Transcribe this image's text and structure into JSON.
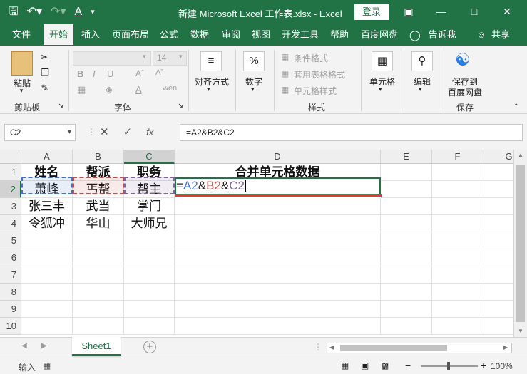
{
  "titlebar": {
    "title": "新建 Microsoft Excel 工作表.xlsx  -  Excel",
    "login": "登录",
    "icons": [
      "save-icon",
      "undo-icon",
      "redo-icon",
      "font-color-icon",
      "customize-icon"
    ]
  },
  "tabs": [
    "文件",
    "开始",
    "插入",
    "页面布局",
    "公式",
    "数据",
    "审阅",
    "视图",
    "开发工具",
    "帮助",
    "百度网盘",
    "告诉我",
    "共享"
  ],
  "ribbon": {
    "paste": "粘贴",
    "clipboard": "剪贴板",
    "font_size": "14",
    "font_group": "字体",
    "align": "对齐方式",
    "number": "数字",
    "cond_format": "条件格式",
    "table_format": "套用表格格式",
    "cell_style": "单元格样式",
    "style_group": "样式",
    "cells": "单元格",
    "edit": "编辑",
    "save_baidu": "保存到",
    "save_baidu2": "百度网盘",
    "save_group": "保存"
  },
  "formula_bar": {
    "name_box": "C2",
    "formula": "=A2&B2&C2"
  },
  "columns": [
    "A",
    "B",
    "C",
    "D",
    "E",
    "F",
    "G"
  ],
  "rows": [
    "1",
    "2",
    "3",
    "4",
    "5",
    "6",
    "7",
    "8",
    "9",
    "10"
  ],
  "cells": {
    "A1": "姓名",
    "B1": "帮派",
    "C1": "职务",
    "D1": "合并单元格数据",
    "A2": "萧峰",
    "B2": "丐帮",
    "C2": "帮主",
    "A3": "张三丰",
    "B3": "武当",
    "C3": "掌门",
    "A4": "令狐冲",
    "B4": "华山",
    "C4": "大师兄"
  },
  "editing": {
    "eq": "=",
    "a": "A2",
    "amp1": "&",
    "b": "B2",
    "amp2": "&",
    "c": "C2"
  },
  "sheet_tab": "Sheet1",
  "status": {
    "mode": "输入",
    "zoom": "100%"
  },
  "colors": {
    "brand": "#217346",
    "ref_a": "#4472c4",
    "ref_b": "#c0504d",
    "ref_c": "#8064a2"
  }
}
